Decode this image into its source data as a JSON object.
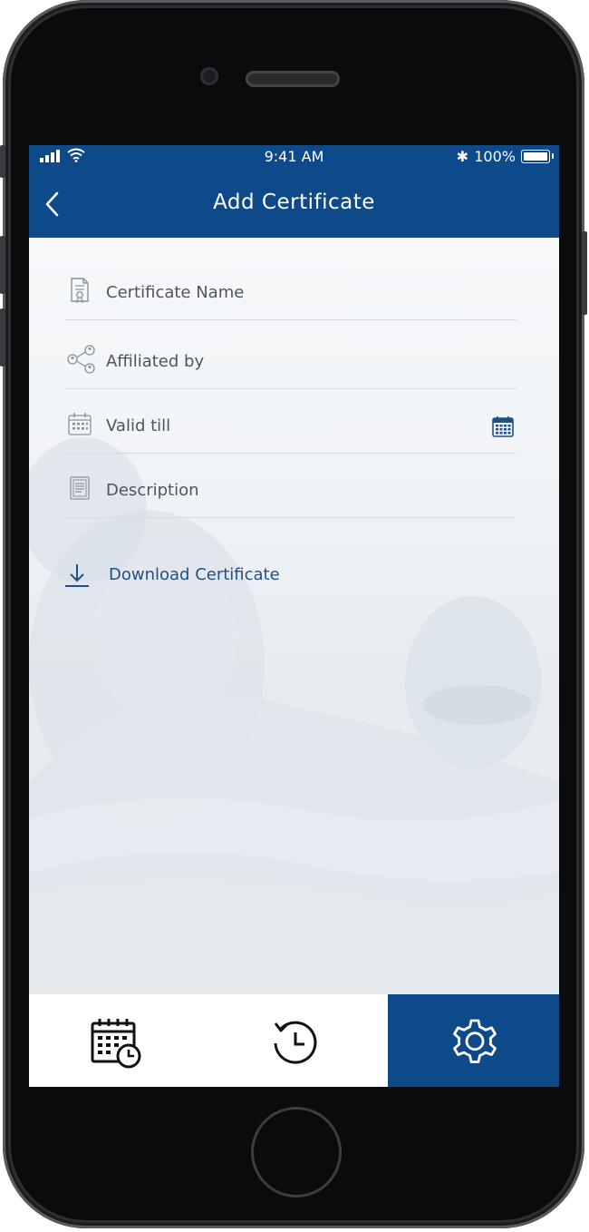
{
  "status_bar": {
    "time": "9:41 AM",
    "battery": "100%"
  },
  "header": {
    "title": "Add Certificate"
  },
  "form": {
    "fields": [
      {
        "label": "Certificate Name",
        "icon": "certificate-icon"
      },
      {
        "label": "Affiliated by",
        "icon": "affiliation-network-icon"
      },
      {
        "label": "Valid till",
        "icon": "calendar-icon"
      },
      {
        "label": "Description",
        "icon": "document-icon"
      }
    ],
    "download_label": "Download Certificate"
  },
  "tabs": [
    {
      "name": "schedule",
      "icon": "calendar-clock-icon",
      "active": false
    },
    {
      "name": "history",
      "icon": "history-icon",
      "active": false
    },
    {
      "name": "settings",
      "icon": "settings-gear-icon",
      "active": true
    }
  ],
  "colors": {
    "primary": "#0e4a8a",
    "text": "#4e5560",
    "link": "#1e4f86"
  }
}
